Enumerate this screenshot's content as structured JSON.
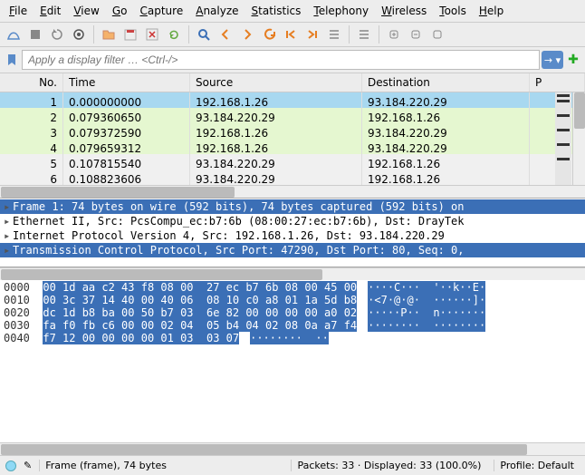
{
  "menu": [
    "File",
    "Edit",
    "View",
    "Go",
    "Capture",
    "Analyze",
    "Statistics",
    "Telephony",
    "Wireless",
    "Tools",
    "Help"
  ],
  "filter": {
    "placeholder": "Apply a display filter … <Ctrl-/>"
  },
  "columns": {
    "no": "No.",
    "time": "Time",
    "source": "Source",
    "destination": "Destination",
    "protocol": "P"
  },
  "packets": [
    {
      "no": "1",
      "time": "0.000000000",
      "src": "192.168.1.26",
      "dst": "93.184.220.29",
      "sel": true
    },
    {
      "no": "2",
      "time": "0.079360650",
      "src": "93.184.220.29",
      "dst": "192.168.1.26",
      "http": true
    },
    {
      "no": "3",
      "time": "0.079372590",
      "src": "192.168.1.26",
      "dst": "93.184.220.29",
      "http": true
    },
    {
      "no": "4",
      "time": "0.079659312",
      "src": "192.168.1.26",
      "dst": "93.184.220.29",
      "http": true
    },
    {
      "no": "5",
      "time": "0.107815540",
      "src": "93.184.220.29",
      "dst": "192.168.1.26"
    },
    {
      "no": "6",
      "time": "0.108823606",
      "src": "93.184.220.29",
      "dst": "192.168.1.26"
    }
  ],
  "details": [
    {
      "text": "Frame 1: 74 bytes on wire (592 bits), 74 bytes captured (592 bits) on",
      "sel": true,
      "exp": true
    },
    {
      "text": "Ethernet II, Src: PcsCompu_ec:b7:6b (08:00:27:ec:b7:6b), Dst: DrayTek",
      "exp": true
    },
    {
      "text": "Internet Protocol Version 4, Src: 192.168.1.26, Dst: 93.184.220.29",
      "exp": true
    },
    {
      "text": "Transmission Control Protocol, Src Port: 47290, Dst Port: 80, Seq: 0,",
      "sel": true,
      "exp": true
    }
  ],
  "hex": [
    {
      "off": "0000",
      "b": "00 1d aa c2 43 f8 08 00  27 ec b7 6b 08 00 45 00",
      "a": "····C···  '··k··E·"
    },
    {
      "off": "0010",
      "b": "00 3c 37 14 40 00 40 06  08 10 c0 a8 01 1a 5d b8",
      "a": "·<7·@·@·  ······]·"
    },
    {
      "off": "0020",
      "b": "dc 1d b8 ba 00 50 b7 03  6e 82 00 00 00 00 a0 02",
      "a": "·····P··  n·······"
    },
    {
      "off": "0030",
      "b": "fa f0 fb c6 00 00 02 04  05 b4 04 02 08 0a a7 f4",
      "a": "········  ········"
    },
    {
      "off": "0040",
      "b": "f7 12 00 00 00 00 01 03  03 07",
      "a": "········  ··",
      "short": true
    }
  ],
  "status": {
    "frame": "Frame (frame), 74 bytes",
    "packets": "Packets: 33 · Displayed: 33 (100.0%)",
    "profile": "Profile: Default"
  }
}
